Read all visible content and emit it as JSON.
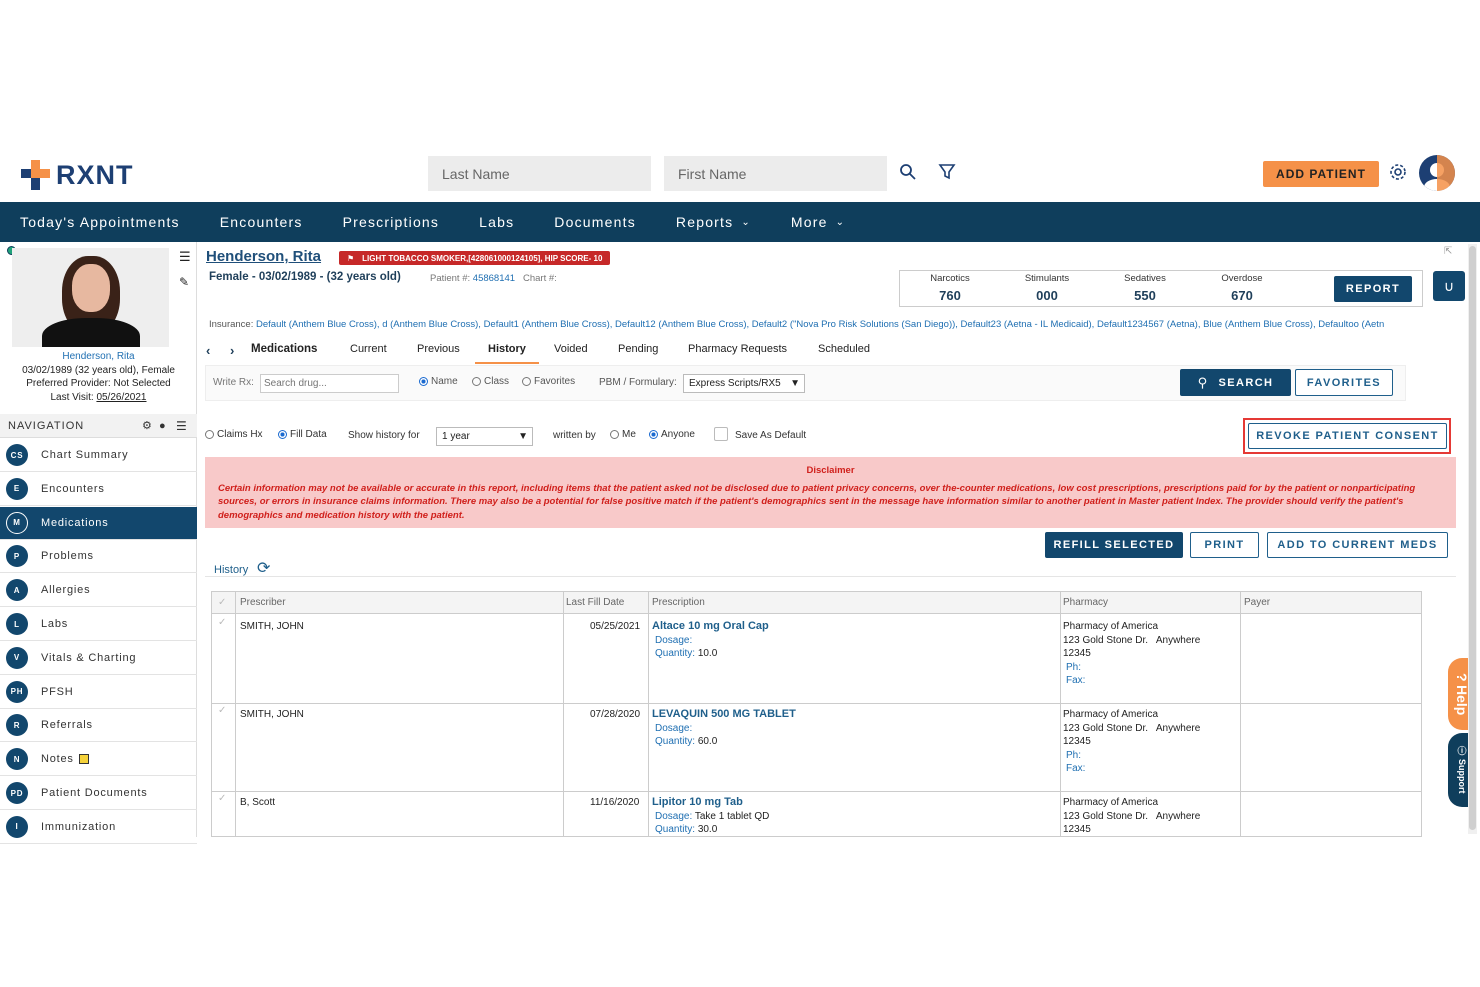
{
  "header": {
    "logo_text": "RXNT",
    "last_name_placeholder": "Last Name",
    "first_name_placeholder": "First Name",
    "add_patient_label": "ADD PATIENT"
  },
  "topnav": {
    "items": [
      "Today's Appointments",
      "Encounters",
      "Prescriptions",
      "Labs",
      "Documents",
      "Reports",
      "More"
    ]
  },
  "patient": {
    "name": "Henderson, Rita",
    "badge": "LIGHT TOBACCO SMOKER,[428061000124105], HIP SCORE- 10",
    "demographics": "Female - 03/02/1989 - (32 years old)",
    "patient_no_label": "Patient #:",
    "patient_no": "45868141",
    "chart_label": "Chart #:",
    "side_name": "Henderson, Rita",
    "side_demo": "03/02/1989 (32 years old), Female",
    "side_provider": "Preferred Provider: Not Selected",
    "side_last_visit_label": "Last Visit:",
    "side_last_visit": "05/26/2021"
  },
  "pdmp": {
    "narcotics_label": "Narcotics",
    "narcotics": "760",
    "stimulants_label": "Stimulants",
    "stimulants": "000",
    "sedatives_label": "Sedatives",
    "sedatives": "550",
    "overdose_label": "Overdose",
    "overdose": "670",
    "report_label": "REPORT"
  },
  "insurance": {
    "label": "Insurance:",
    "value": "Default (Anthem Blue Cross), d (Anthem Blue Cross), Default1 (Anthem Blue Cross), Default12 (Anthem Blue Cross), Default2 (\"Nova Pro Risk Solutions (San Diego)), Default23 (Aetna - IL Medicaid), Default1234567 (Aetna), Blue (Anthem Blue Cross), Defaultoo (Aetn"
  },
  "sidebar": {
    "nav_title": "NAVIGATION",
    "items": [
      {
        "abbr": "CS",
        "label": "Chart Summary"
      },
      {
        "abbr": "E",
        "label": "Encounters"
      },
      {
        "abbr": "M",
        "label": "Medications"
      },
      {
        "abbr": "P",
        "label": "Problems"
      },
      {
        "abbr": "A",
        "label": "Allergies"
      },
      {
        "abbr": "L",
        "label": "Labs"
      },
      {
        "abbr": "V",
        "label": "Vitals & Charting"
      },
      {
        "abbr": "PH",
        "label": "PFSH"
      },
      {
        "abbr": "R",
        "label": "Referrals"
      },
      {
        "abbr": "N",
        "label": "Notes"
      },
      {
        "abbr": "PD",
        "label": "Patient Documents"
      },
      {
        "abbr": "I",
        "label": "Immunization"
      }
    ]
  },
  "tabs": {
    "section": "Medications",
    "items": [
      "Current",
      "Previous",
      "History",
      "Voided",
      "Pending",
      "Pharmacy Requests",
      "Scheduled"
    ],
    "active": "History"
  },
  "write_rx": {
    "label": "Write Rx:",
    "placeholder": "Search drug...",
    "opt_name": "Name",
    "opt_class": "Class",
    "opt_favorites": "Favorites",
    "pbm_label": "PBM / Formulary:",
    "pbm_value": "Express Scripts/RX5",
    "search_label": "SEARCH",
    "favorites_label": "FAVORITES"
  },
  "filters": {
    "claims": "Claims Hx",
    "fill": "Fill Data",
    "show_history_for": "Show history for",
    "period": "1 year",
    "written_by": "written by",
    "me": "Me",
    "anyone": "Anyone",
    "save_default": "Save As Default",
    "revoke_label": "REVOKE PATIENT CONSENT"
  },
  "disclaimer": {
    "title": "Disclaimer",
    "text": "Certain information may not be available or accurate in this report, including items that the patient asked not be disclosed due to patient privacy concerns, over the-counter medications, low cost prescriptions, prescriptions paid for by the patient or nonparticipating sources, or errors in insurance claims information. There may also be a potential for false positive match if the patient's demographics sent in the message have information similar to another patient in Master patient Index. The provider should verify the patient's demographics and medication history with the patient."
  },
  "actions": {
    "refill": "REFILL SELECTED",
    "print": "PRINT",
    "add_current": "ADD TO CURRENT MEDS"
  },
  "history": {
    "title": "History",
    "columns": [
      "Prescriber",
      "Last Fill Date",
      "Prescription",
      "Pharmacy",
      "Payer"
    ],
    "dosage_label": "Dosage:",
    "quantity_label": "Quantity:",
    "ph_label": "Ph:",
    "fax_label": "Fax:",
    "rows": [
      {
        "prescriber": "SMITH, JOHN",
        "date": "05/25/2021",
        "drug": "Altace 10 mg Oral Cap",
        "dosage": "",
        "quantity": "10.0",
        "pharmacy": "Pharmacy of America",
        "addr1": "123 Gold Stone Dr.   Anywhere",
        "zip": "12345"
      },
      {
        "prescriber": "SMITH, JOHN",
        "date": "07/28/2020",
        "drug": "LEVAQUIN 500 MG TABLET",
        "dosage": "",
        "quantity": "60.0",
        "pharmacy": "Pharmacy of America",
        "addr1": "123 Gold Stone Dr.   Anywhere",
        "zip": "12345"
      },
      {
        "prescriber": "B, Scott",
        "date": "11/16/2020",
        "drug": "Lipitor 10 mg Tab",
        "dosage": "Take 1 tablet QD",
        "quantity": "30.0",
        "pharmacy": "Pharmacy of America",
        "addr1": "123 Gold Stone Dr.   Anywhere",
        "zip": "12345"
      }
    ]
  },
  "help": {
    "help_label": "Help",
    "support_label": "Support"
  },
  "colors": {
    "navy": "#0f3e5c",
    "accent": "#f59148",
    "alert": "#c62828",
    "disclaimer_bg": "#f8c9c9"
  }
}
